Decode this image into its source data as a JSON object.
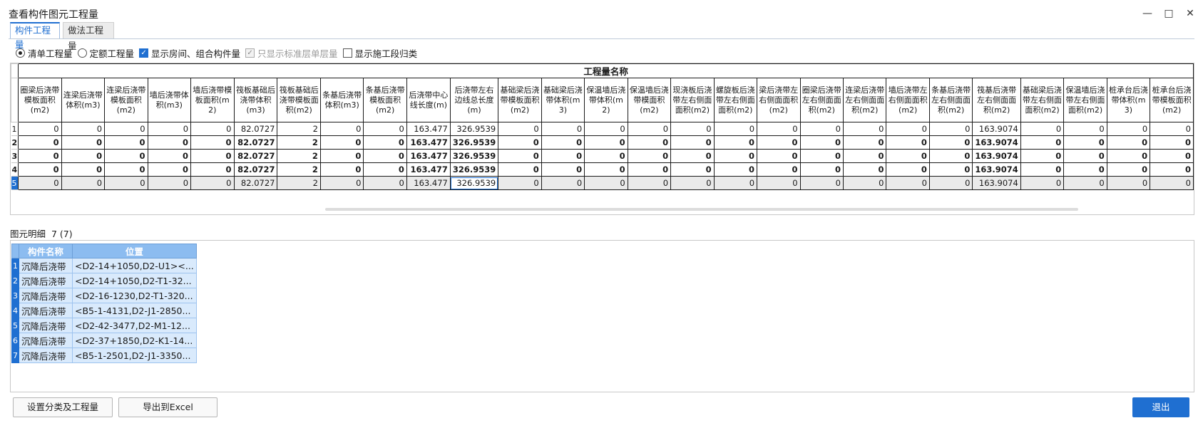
{
  "window": {
    "title": "查看构件图元工程量"
  },
  "tabs": [
    "构件工程量",
    "做法工程量"
  ],
  "options": {
    "radio_list": "清单工程量",
    "radio_quota": "定额工程量",
    "show_rooms": "显示房间、组合构件量",
    "only_std_floor": "只显示标准层单层量",
    "show_stage": "显示施工段归类"
  },
  "grid": {
    "group_header": "工程量名称",
    "columns": [
      "圈梁后浇带模板面积(m2)",
      "连梁后浇带体积(m3)",
      "连梁后浇带模板面积(m2)",
      "墙后浇带体积(m3)",
      "墙后浇带模板面积(m2)",
      "筏板基础后浇带体积(m3)",
      "筏板基础后浇带模板面积(m2)",
      "条基后浇带体积(m3)",
      "条基后浇带模板面积(m2)",
      "后浇带中心线长度(m)",
      "后浇带左右边线总长度(m)",
      "基础梁后浇带模板面积(m2)",
      "基础梁后浇带体积(m3)",
      "保温墙后浇带体积(m2)",
      "保温墙后浇带模面积(m2)",
      "现浇板后浇带左右侧面面积(m2)",
      "螺旋板后浇带左右侧面面积(m2)",
      "梁后浇带左右侧面面积(m2)",
      "圈梁后浇带左右侧面面积(m2)",
      "连梁后浇带左右侧面面积(m2)",
      "墙后浇带左右侧面面积(m2)",
      "条基后浇带左右侧面面积(m2)",
      "筏基后浇带左右侧面面积(m2)",
      "基础梁后浇带左右侧面面积(m2)",
      "保温墙后浇带左右侧面面积(m2)",
      "桩承台后浇带体积(m3)",
      "桩承台后浇带模板面积(m2)"
    ],
    "rows": [
      {
        "n": "1",
        "cells": [
          "0",
          "0",
          "0",
          "0",
          "0",
          "82.0727",
          "2",
          "0",
          "0",
          "163.477",
          "326.9539",
          "0",
          "0",
          "0",
          "0",
          "0",
          "0",
          "0",
          "0",
          "0",
          "0",
          "0",
          "163.9074",
          "0",
          "0",
          "0",
          "0"
        ]
      },
      {
        "n": "2",
        "cells": [
          "0",
          "0",
          "0",
          "0",
          "0",
          "82.0727",
          "2",
          "0",
          "0",
          "163.477",
          "326.9539",
          "0",
          "0",
          "0",
          "0",
          "0",
          "0",
          "0",
          "0",
          "0",
          "0",
          "0",
          "163.9074",
          "0",
          "0",
          "0",
          "0"
        ]
      },
      {
        "n": "3",
        "cells": [
          "0",
          "0",
          "0",
          "0",
          "0",
          "82.0727",
          "2",
          "0",
          "0",
          "163.477",
          "326.9539",
          "0",
          "0",
          "0",
          "0",
          "0",
          "0",
          "0",
          "0",
          "0",
          "0",
          "0",
          "163.9074",
          "0",
          "0",
          "0",
          "0"
        ]
      },
      {
        "n": "4",
        "cells": [
          "0",
          "0",
          "0",
          "0",
          "0",
          "82.0727",
          "2",
          "0",
          "0",
          "163.477",
          "326.9539",
          "0",
          "0",
          "0",
          "0",
          "0",
          "0",
          "0",
          "0",
          "0",
          "0",
          "0",
          "163.9074",
          "0",
          "0",
          "0",
          "0"
        ]
      },
      {
        "n": "5",
        "cells": [
          "0",
          "0",
          "0",
          "0",
          "0",
          "82.0727",
          "2",
          "0",
          "0",
          "163.477",
          "326.9539",
          "0",
          "0",
          "0",
          "0",
          "0",
          "0",
          "0",
          "0",
          "0",
          "0",
          "0",
          "163.9074",
          "0",
          "0",
          "0",
          "0"
        ]
      }
    ]
  },
  "detail": {
    "label": "图元明细",
    "count": "7 (7)",
    "headers": [
      "构件名称",
      "位置"
    ],
    "rows": [
      {
        "n": "1",
        "name": "沉降后浇带",
        "pos": "<D2-14+1050,D2-U1><..."
      },
      {
        "n": "2",
        "name": "沉降后浇带",
        "pos": "<D2-14+1050,D2-T1-32..."
      },
      {
        "n": "3",
        "name": "沉降后浇带",
        "pos": "<D2-16-1230,D2-T1-320..."
      },
      {
        "n": "4",
        "name": "沉降后浇带",
        "pos": "<B5-1-4131,D2-J1-2850..."
      },
      {
        "n": "5",
        "name": "沉降后浇带",
        "pos": "<D2-42-3477,D2-M1-12..."
      },
      {
        "n": "6",
        "name": "沉降后浇带",
        "pos": "<D2-37+1850,D2-K1-14..."
      },
      {
        "n": "7",
        "name": "沉降后浇带",
        "pos": "<B5-1-2501,D2-J1-3350..."
      }
    ]
  },
  "buttons": {
    "set_category": "设置分类及工程量",
    "export_excel": "导出到Excel",
    "exit": "退出"
  },
  "colors": {
    "accent": "#1f6fd1",
    "detail_header": "#8cbcf0",
    "detail_cell": "#d9eafc"
  }
}
